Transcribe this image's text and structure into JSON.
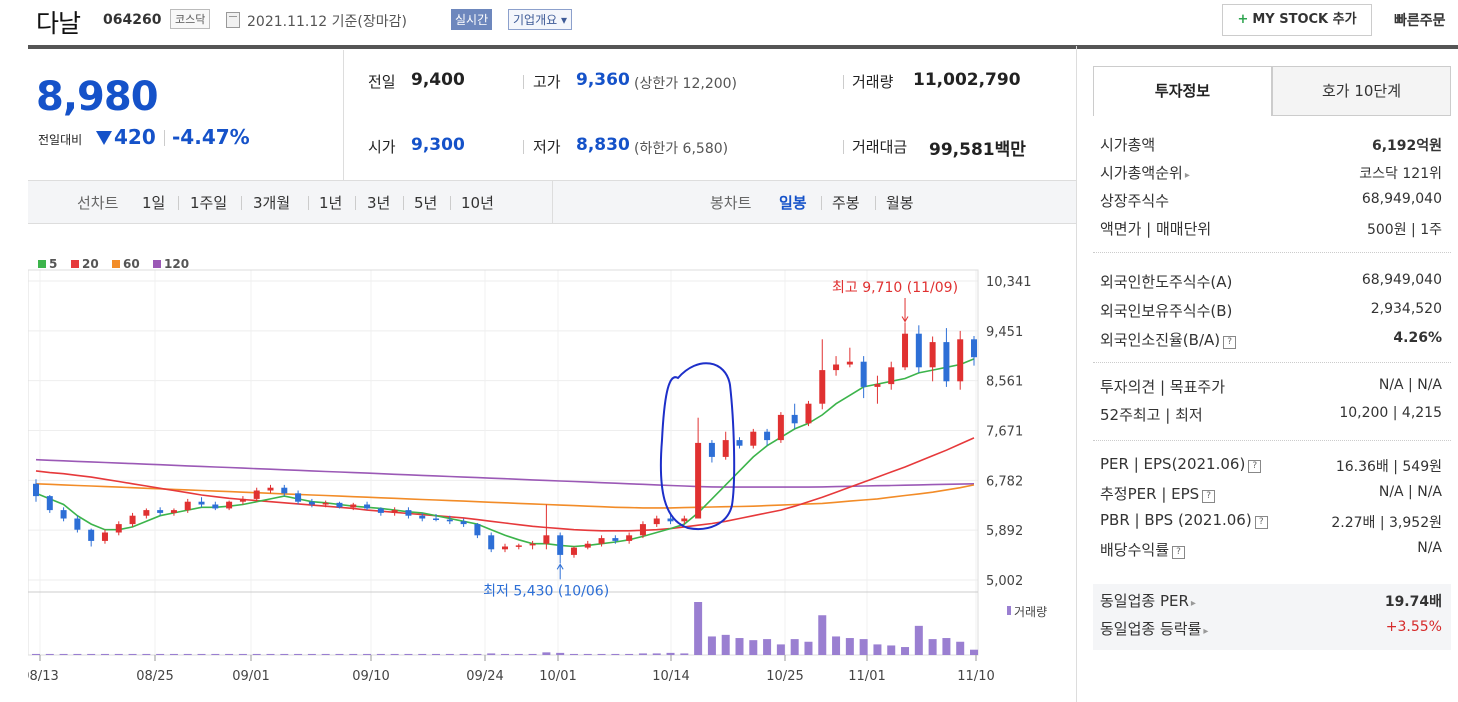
{
  "stock": {
    "name": "다날",
    "code": "064260",
    "market": "코스닥",
    "date": "2021.11.12 기준(장마감)",
    "live_label": "실시간",
    "overview_label": "기업개요 ▾",
    "mystock_label": "MY STOCK 추가",
    "mystock_plus": "+",
    "quick_order": "빠른주문"
  },
  "price": {
    "current": "8,980",
    "diff_label": "전일대비",
    "diff": "420",
    "diff_pct": "-4.47%"
  },
  "stats": {
    "prev_label": "전일",
    "prev": "9,400",
    "high_label": "고가",
    "high": "9,360",
    "upper_limit": "(상한가 12,200)",
    "volume_label": "거래량",
    "volume": "11,002,790",
    "open_label": "시가",
    "open": "9,300",
    "low_label": "저가",
    "low": "8,830",
    "lower_limit": "(하한가 6,580)",
    "amount_label": "거래대금",
    "amount": "99,581",
    "amount_unit": "백만"
  },
  "periodbar": {
    "line_label": "선차트",
    "line_items": [
      "1일",
      "1주일",
      "3개월",
      "1년",
      "3년",
      "5년",
      "10년"
    ],
    "candle_label": "봉차트",
    "candle_items": [
      "일봉",
      "주봉",
      "월봉"
    ],
    "active_candle": "일봉"
  },
  "right_panel": {
    "tab_active": "투자정보",
    "tab_inactive": "호가 10단계",
    "rows1": [
      {
        "label": "시가총액",
        "value": "6,192억원",
        "bold": true
      },
      {
        "label": "시가총액순위",
        "value": "코스닥 121위",
        "arrow": true
      },
      {
        "label": "상장주식수",
        "value": "68,949,040"
      },
      {
        "label": "액면가 | 매매단위",
        "value": "500원 | 1주"
      }
    ],
    "rows2": [
      {
        "label": "외국인한도주식수(A)",
        "value": "68,949,040"
      },
      {
        "label": "외국인보유주식수(B)",
        "value": "2,934,520"
      },
      {
        "label": "외국인소진율(B/A)",
        "value": "4.26%",
        "bold": true,
        "q": true
      }
    ],
    "rows3": [
      {
        "label": "투자의견 | 목표주가",
        "value": "N/A | N/A"
      },
      {
        "label": "52주최고 | 최저",
        "value": "10,200 | 4,215"
      }
    ],
    "rows4": [
      {
        "label": "PER | EPS(2021.06)",
        "value": "16.36배 | 549원",
        "q": true
      },
      {
        "label": "추정PER | EPS",
        "value": "N/A | N/A",
        "q": true
      },
      {
        "label": "PBR | BPS (2021.06)",
        "value": "2.27배 | 3,952원",
        "q": true
      },
      {
        "label": "배당수익률",
        "value": "N/A",
        "q": true
      }
    ],
    "rows5": [
      {
        "label": "동일업종 PER",
        "value": "19.74배",
        "bold": true,
        "arrow": true
      },
      {
        "label": "동일업종 등락률",
        "value": "+3.55%",
        "red": true,
        "arrow": true
      }
    ],
    "q_mark": "?",
    "arrow_mark": "▸"
  },
  "chart_data": {
    "type": "candlestick",
    "legend": [
      {
        "name": "5",
        "color": "#3cb44b"
      },
      {
        "name": "20",
        "color": "#e6393b"
      },
      {
        "name": "60",
        "color": "#f28c28"
      },
      {
        "name": "120",
        "color": "#9b59b6"
      }
    ],
    "y_ticks": [
      "10,341",
      "9,451",
      "8,561",
      "7,671",
      "6,782",
      "5,892",
      "5,002"
    ],
    "ylim": [
      5002,
      10341
    ],
    "x_ticks": [
      "08/13",
      "08/25",
      "09/01",
      "09/10",
      "09/24",
      "10/01",
      "10/14",
      "10/25",
      "11/01",
      "11/10"
    ],
    "high_annotation": "최고 9,710 (11/09)",
    "low_annotation": "최저 5,430 (10/06)",
    "volume_label": "거래량",
    "candles": [
      [
        6720,
        6800,
        6400,
        6500
      ],
      [
        6500,
        6520,
        6200,
        6250
      ],
      [
        6250,
        6300,
        6050,
        6100
      ],
      [
        6100,
        6150,
        5850,
        5900
      ],
      [
        5900,
        5920,
        5600,
        5700
      ],
      [
        5700,
        5900,
        5650,
        5850
      ],
      [
        5850,
        6050,
        5800,
        6000
      ],
      [
        6000,
        6200,
        5950,
        6150
      ],
      [
        6150,
        6280,
        6100,
        6250
      ],
      [
        6250,
        6300,
        6150,
        6200
      ],
      [
        6200,
        6280,
        6150,
        6250
      ],
      [
        6250,
        6450,
        6200,
        6400
      ],
      [
        6400,
        6480,
        6300,
        6350
      ],
      [
        6350,
        6400,
        6250,
        6280
      ],
      [
        6280,
        6420,
        6250,
        6400
      ],
      [
        6400,
        6500,
        6350,
        6450
      ],
      [
        6450,
        6650,
        6400,
        6600
      ],
      [
        6600,
        6700,
        6550,
        6650
      ],
      [
        6650,
        6700,
        6500,
        6550
      ],
      [
        6550,
        6600,
        6350,
        6400
      ],
      [
        6400,
        6450,
        6300,
        6350
      ],
      [
        6350,
        6420,
        6300,
        6380
      ],
      [
        6380,
        6400,
        6280,
        6300
      ],
      [
        6300,
        6380,
        6250,
        6350
      ],
      [
        6350,
        6400,
        6250,
        6280
      ],
      [
        6280,
        6300,
        6150,
        6200
      ],
      [
        6200,
        6300,
        6150,
        6250
      ],
      [
        6250,
        6300,
        6100,
        6150
      ],
      [
        6150,
        6200,
        6050,
        6100
      ],
      [
        6100,
        6180,
        6050,
        6080
      ],
      [
        6080,
        6150,
        6000,
        6050
      ],
      [
        6050,
        6100,
        5950,
        6000
      ],
      [
        6000,
        6020,
        5750,
        5800
      ],
      [
        5800,
        5850,
        5500,
        5550
      ],
      [
        5550,
        5650,
        5500,
        5600
      ],
      [
        5600,
        5650,
        5550,
        5620
      ],
      [
        5620,
        5700,
        5550,
        5650
      ],
      [
        5650,
        6350,
        5550,
        5800
      ],
      [
        5800,
        5850,
        5300,
        5450
      ],
      [
        5450,
        5600,
        5400,
        5580
      ],
      [
        5580,
        5700,
        5550,
        5650
      ],
      [
        5650,
        5800,
        5600,
        5750
      ],
      [
        5750,
        5800,
        5650,
        5700
      ],
      [
        5700,
        5850,
        5650,
        5800
      ],
      [
        5800,
        6050,
        5750,
        6000
      ],
      [
        6000,
        6150,
        5950,
        6100
      ],
      [
        6100,
        6200,
        6000,
        6050
      ],
      [
        6050,
        6150,
        6000,
        6100
      ],
      [
        6100,
        7900,
        6100,
        7450
      ],
      [
        7450,
        7500,
        7100,
        7200
      ],
      [
        7200,
        7650,
        7150,
        7500
      ],
      [
        7500,
        7550,
        7350,
        7400
      ],
      [
        7400,
        7700,
        7350,
        7650
      ],
      [
        7650,
        7700,
        7400,
        7500
      ],
      [
        7500,
        8000,
        7450,
        7950
      ],
      [
        7950,
        8150,
        7700,
        7800
      ],
      [
        7800,
        8200,
        7750,
        8150
      ],
      [
        8150,
        9300,
        8050,
        8750
      ],
      [
        8750,
        9000,
        8650,
        8850
      ],
      [
        8850,
        9150,
        8800,
        8900
      ],
      [
        8900,
        9000,
        8250,
        8450
      ],
      [
        8450,
        8650,
        8150,
        8500
      ],
      [
        8500,
        8900,
        8400,
        8800
      ],
      [
        8800,
        9600,
        8750,
        9400
      ],
      [
        9400,
        9550,
        8700,
        8800
      ],
      [
        8800,
        9350,
        8550,
        9250
      ],
      [
        9250,
        9500,
        8450,
        8550
      ],
      [
        8550,
        9450,
        8400,
        9300
      ],
      [
        9300,
        9360,
        8830,
        8980
      ]
    ],
    "volumes": [
      0.02,
      0.02,
      0.02,
      0.02,
      0.02,
      0.02,
      0.02,
      0.02,
      0.02,
      0.02,
      0.02,
      0.02,
      0.02,
      0.02,
      0.02,
      0.02,
      0.02,
      0.02,
      0.02,
      0.02,
      0.02,
      0.02,
      0.02,
      0.02,
      0.02,
      0.02,
      0.02,
      0.02,
      0.02,
      0.02,
      0.02,
      0.02,
      0.02,
      0.03,
      0.02,
      0.02,
      0.02,
      0.05,
      0.04,
      0.02,
      0.02,
      0.02,
      0.02,
      0.02,
      0.03,
      0.03,
      0.04,
      0.03,
      1.0,
      0.35,
      0.38,
      0.32,
      0.28,
      0.3,
      0.2,
      0.3,
      0.25,
      0.75,
      0.35,
      0.32,
      0.3,
      0.2,
      0.18,
      0.15,
      0.55,
      0.3,
      0.32,
      0.25,
      0.1
    ],
    "ma5": [
      6550,
      6450,
      6350,
      6150,
      6000,
      5900,
      5900,
      5950,
      6050,
      6150,
      6200,
      6250,
      6300,
      6300,
      6320,
      6350,
      6400,
      6450,
      6500,
      6450,
      6400,
      6380,
      6350,
      6320,
      6300,
      6280,
      6250,
      6220,
      6200,
      6150,
      6100,
      6050,
      6000,
      5900,
      5800,
      5720,
      5650,
      5650,
      5620,
      5600,
      5620,
      5650,
      5680,
      5720,
      5780,
      5850,
      5920,
      6000,
      6200,
      6450,
      6700,
      6950,
      7200,
      7400,
      7550,
      7700,
      7800,
      7950,
      8150,
      8300,
      8450,
      8500,
      8550,
      8600,
      8700,
      8750,
      8800,
      8850,
      8950
    ],
    "ma20": [
      6950,
      6920,
      6900,
      6870,
      6840,
      6800,
      6760,
      6720,
      6680,
      6640,
      6600,
      6560,
      6520,
      6490,
      6460,
      6440,
      6420,
      6400,
      6380,
      6360,
      6340,
      6320,
      6300,
      6280,
      6250,
      6230,
      6210,
      6190,
      6170,
      6150,
      6130,
      6110,
      6080,
      6050,
      6020,
      5990,
      5960,
      5940,
      5920,
      5900,
      5890,
      5880,
      5880,
      5880,
      5890,
      5900,
      5920,
      5950,
      5980,
      6010,
      6050,
      6100,
      6150,
      6200,
      6250,
      6320,
      6400,
      6480,
      6570,
      6660,
      6750,
      6840,
      6930,
      7020,
      7120,
      7220,
      7320,
      7430,
      7540
    ],
    "ma60": [
      6720,
      6710,
      6700,
      6690,
      6680,
      6670,
      6660,
      6650,
      6640,
      6630,
      6620,
      6610,
      6600,
      6590,
      6580,
      6570,
      6560,
      6550,
      6540,
      6530,
      6520,
      6510,
      6500,
      6490,
      6480,
      6470,
      6460,
      6450,
      6440,
      6430,
      6420,
      6410,
      6400,
      6390,
      6380,
      6370,
      6360,
      6350,
      6340,
      6330,
      6320,
      6310,
      6300,
      6295,
      6290,
      6290,
      6290,
      6295,
      6300,
      6305,
      6310,
      6315,
      6320,
      6330,
      6340,
      6350,
      6360,
      6370,
      6390,
      6410,
      6430,
      6450,
      6480,
      6510,
      6540,
      6570,
      6610,
      6650,
      6700
    ],
    "ma120": [
      7150,
      7140,
      7130,
      7120,
      7110,
      7100,
      7090,
      7080,
      7070,
      7060,
      7050,
      7040,
      7030,
      7020,
      7010,
      7000,
      6990,
      6980,
      6970,
      6960,
      6950,
      6940,
      6930,
      6920,
      6910,
      6900,
      6890,
      6880,
      6870,
      6860,
      6850,
      6840,
      6830,
      6820,
      6810,
      6800,
      6790,
      6780,
      6770,
      6760,
      6750,
      6740,
      6730,
      6720,
      6710,
      6700,
      6690,
      6680,
      6670,
      6665,
      6660,
      6660,
      6660,
      6660,
      6660,
      6660,
      6660,
      6665,
      6670,
      6675,
      6680,
      6685,
      6690,
      6695,
      6700,
      6705,
      6710,
      6715,
      6720
    ]
  }
}
